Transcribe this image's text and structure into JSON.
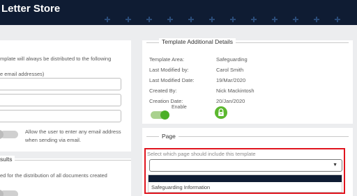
{
  "header": {
    "title": "Letter Store"
  },
  "left_panel": {
    "line1": "mplate will always be distributed to the following",
    "line2": "e email addresses)",
    "toggle_label_1": "Allow the user to enter any email address",
    "toggle_label_2": "when sending via email."
  },
  "left_panel2": {
    "heading": "sults",
    "line1": "ed for the distribution of all documents created"
  },
  "details": {
    "legend": "Template Additional Details",
    "rows": [
      {
        "label": "Template Area:",
        "value": "Safeguarding"
      },
      {
        "label": "Last Modified by:",
        "value": "Carol Smith"
      },
      {
        "label": "Last Modified Date:",
        "value": "19/Mar/2020"
      },
      {
        "label": "Created By:",
        "value": "Nick Mackintosh"
      },
      {
        "label": "Creation Date:",
        "value": "20/Jan/2020"
      }
    ],
    "enable_label": "Enable"
  },
  "page_section": {
    "legend": "Page",
    "select_label": "Select which page should include this template",
    "selected_value": "",
    "options": [
      "",
      "Safeguarding Information"
    ]
  },
  "colors": {
    "header": "#0f1c33",
    "accent_green": "#4caf28",
    "highlight_red": "#e0141e"
  },
  "icons": {
    "lock": "lock-icon",
    "dropdown": "chevron-down-icon"
  }
}
